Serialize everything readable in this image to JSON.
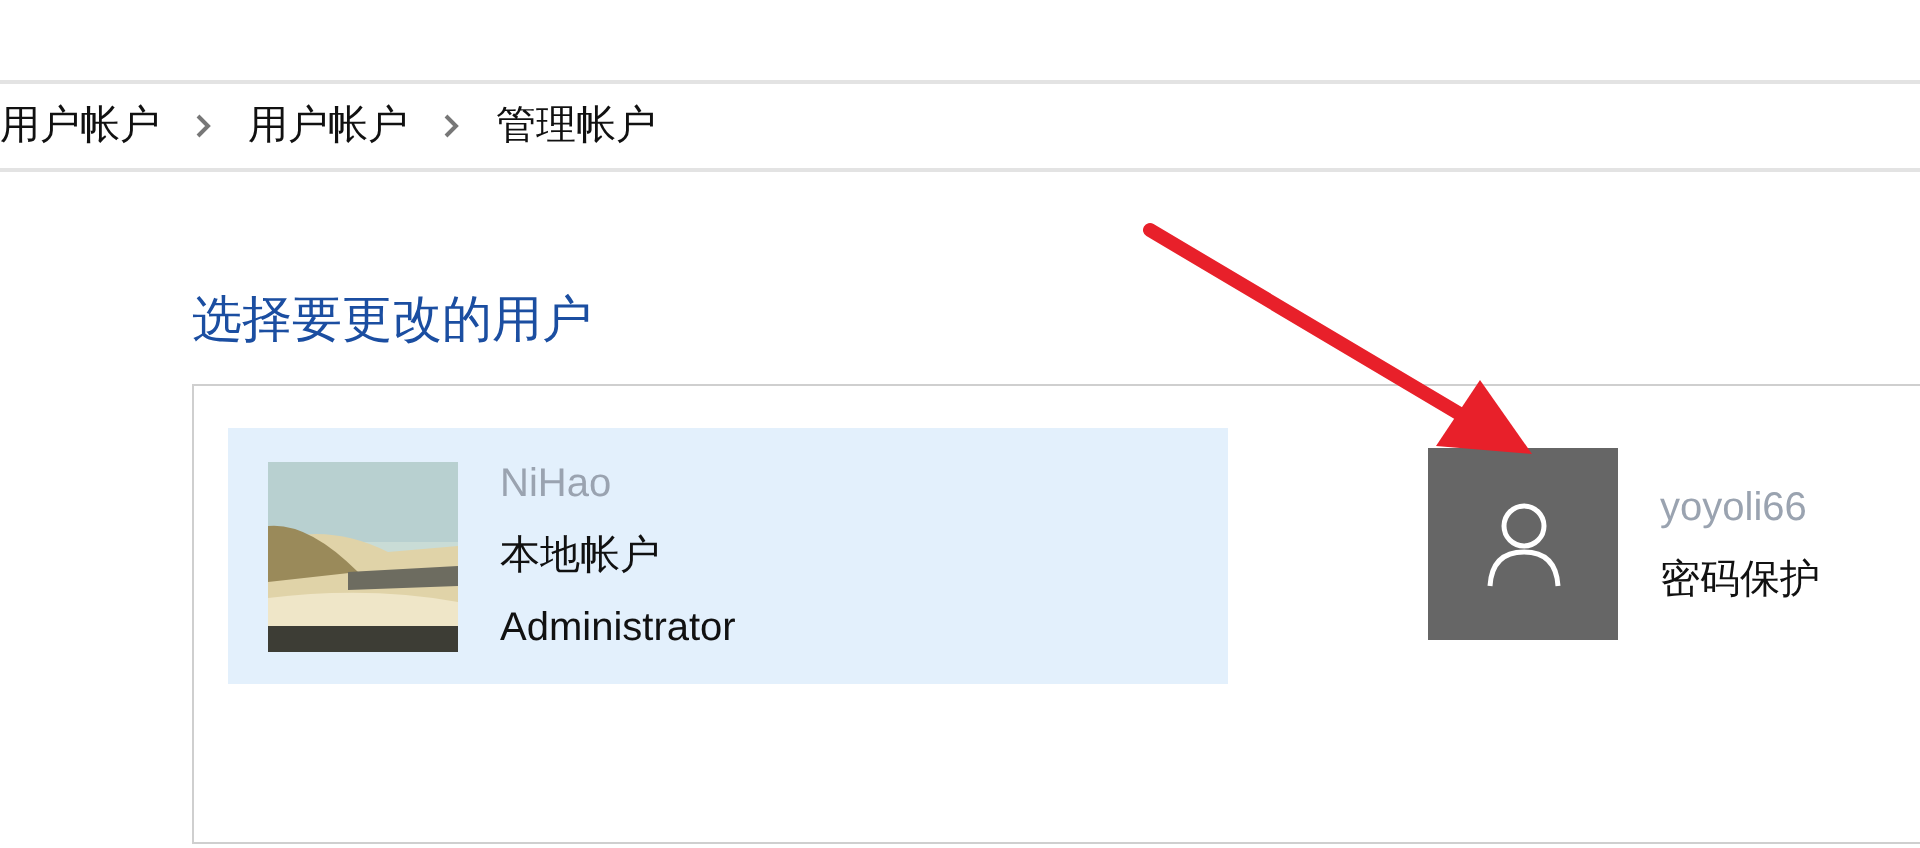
{
  "breadcrumb": [
    "用户帐户",
    "用户帐户",
    "管理帐户"
  ],
  "heading": "选择要更改的用户",
  "accounts": [
    {
      "kind": "picture",
      "name": "NiHao",
      "lines": [
        "本地帐户",
        "Administrator"
      ],
      "selected": true
    },
    {
      "kind": "default",
      "name": "yoyoli66",
      "lines": [
        "密码保护"
      ],
      "selected": false
    }
  ]
}
